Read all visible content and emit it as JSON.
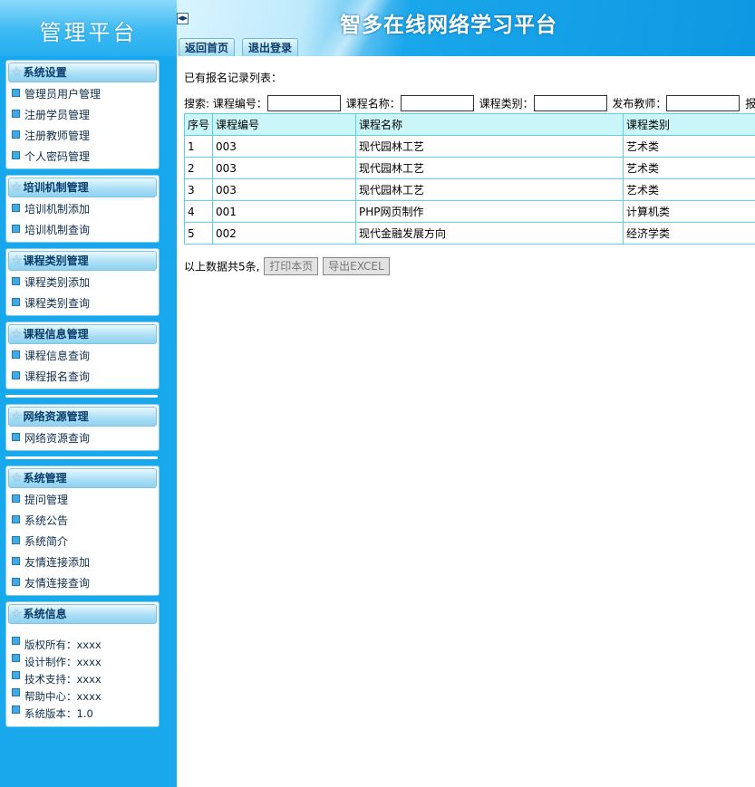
{
  "sidebar": {
    "logo_text": "管理平台",
    "groups": [
      {
        "title": "系统设置",
        "items": [
          "管理员用户管理",
          "注册学员管理",
          "注册教师管理",
          "个人密码管理"
        ]
      },
      {
        "title": "培训机制管理",
        "items": [
          "培训机制添加",
          "培训机制查询"
        ]
      },
      {
        "title": "课程类别管理",
        "items": [
          "课程类别添加",
          "课程类别查询"
        ]
      },
      {
        "title": "课程信息管理",
        "items": [
          "课程信息查询",
          "课程报名查询"
        ]
      },
      {
        "title": "网络资源管理",
        "items": [
          "网络资源查询"
        ]
      },
      {
        "title": "系统管理",
        "items": [
          "提问管理",
          "系统公告",
          "系统简介",
          "友情连接添加",
          "友情连接查询"
        ]
      }
    ],
    "info": {
      "title": "系统信息",
      "items": [
        "版权所有：xxxx",
        "设计制作：xxxx",
        "技术支持：xxxx",
        "帮助中心：xxxx",
        "系统版本：1.0"
      ]
    }
  },
  "header": {
    "title": "智多在线网络学习平台",
    "tabs": [
      "返回首页",
      "退出登录"
    ],
    "toggle_icon": "collapse-toggle-icon"
  },
  "main": {
    "list_heading": "已有报名记录列表：",
    "search": {
      "label": "搜索:",
      "fields": [
        "课程编号：",
        "课程名称：",
        "课程类别：",
        "发布教师：",
        "报名"
      ]
    },
    "table": {
      "headers": [
        "序号",
        "课程编号",
        "课程名称",
        "课程类别"
      ],
      "rows": [
        [
          "1",
          "003",
          "现代园林工艺",
          "艺术类"
        ],
        [
          "2",
          "003",
          "现代园林工艺",
          "艺术类"
        ],
        [
          "3",
          "003",
          "现代园林工艺",
          "艺术类"
        ],
        [
          "4",
          "001",
          "PHP网页制作",
          "计算机类"
        ],
        [
          "5",
          "002",
          "现代金融发展方向",
          "经济学类"
        ]
      ]
    },
    "summary": "以上数据共5条,",
    "print_button": "打印本页",
    "export_button": "导出EXCEL"
  },
  "colors": {
    "sidebar_bg": "#19a8ec",
    "table_border": "#59d3e6",
    "table_header_bg": "#caf6fa"
  }
}
